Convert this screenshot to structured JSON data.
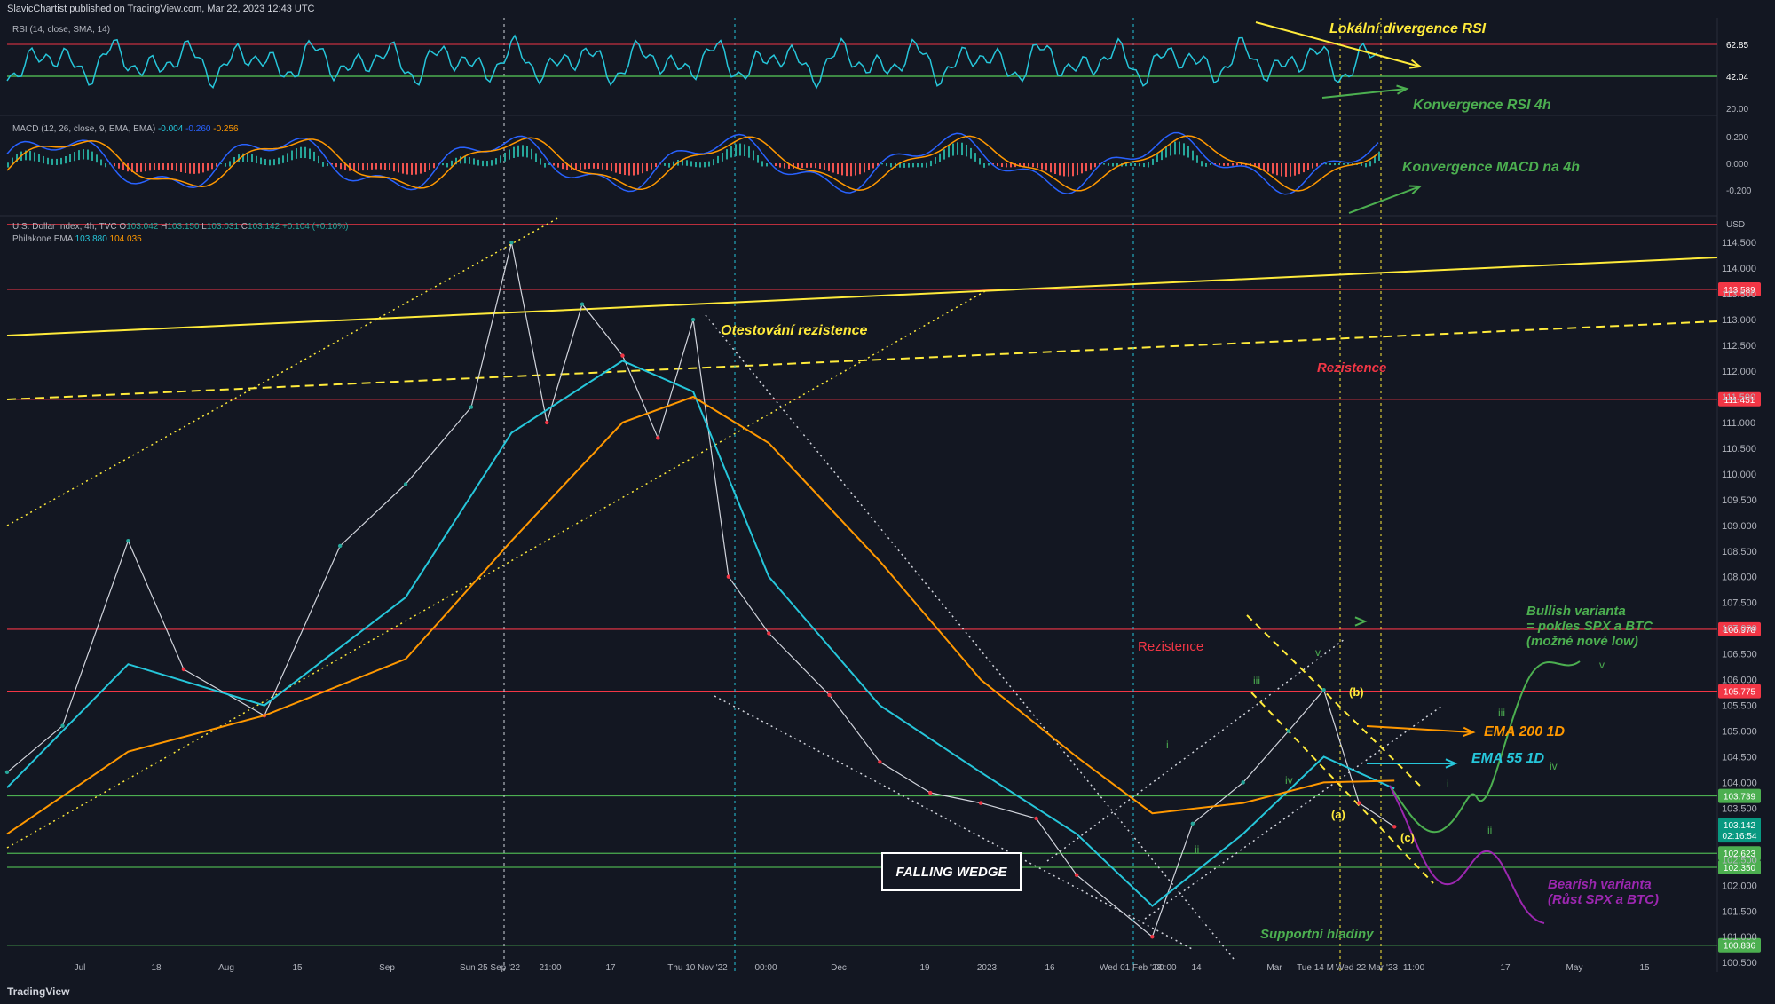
{
  "header": {
    "published": "SlavicChartist published on TradingView.com, Mar 22, 2023 12:43 UTC",
    "brand": "TradingView"
  },
  "rsi_pane": {
    "label": "RSI (14, close, SMA, 14)",
    "axis_ticks": [
      "62.85",
      "42.04",
      "20.00"
    ]
  },
  "macd_pane": {
    "label": "MACD (12, 26, close, 9, EMA, EMA)",
    "hist": "-0.004",
    "macd": "-0.260",
    "signal": "-0.256",
    "axis_ticks": [
      "0.200",
      "0.000",
      "-0.200"
    ]
  },
  "price_pane": {
    "symbol": "U.S. Dollar Index, 4h, TVC",
    "ohlc": {
      "o": "103.042",
      "h": "103.150",
      "l": "103.031",
      "c": "103.142",
      "chg": "+0.104 (+0.10%)"
    },
    "ema_label": "Philakone EMA",
    "ema_fast": "103.880",
    "ema_slow": "104.035",
    "currency": "USD",
    "current_price": "103.142",
    "countdown": "02:16:54"
  },
  "colors": {
    "background": "#131722",
    "rsi": "#26c6da",
    "ema55": "#26c6da",
    "ema200": "#ff9800",
    "resistance": "#f23645",
    "support": "#4caf50",
    "annotation_yellow": "#ffeb3b",
    "bullish": "#4caf50",
    "bearish": "#9c27b0"
  },
  "annotations": {
    "lokalni_divergence": "Lokální divergence RSI",
    "konvergence_rsi": "Konvergence RSI 4h",
    "konvergence_macd": "Konvergence MACD na 4h",
    "otestovani": "Otestování rezistence",
    "rezistence_top": "Rezistence",
    "rezistence_mid": "Rezistence",
    "falling_wedge": "FALLING WEDGE",
    "bullish_1": "Bullish varianta",
    "bullish_2": "= pokles SPX a BTC",
    "bullish_3": "(možné nové low)",
    "ema200": "EMA 200 1D",
    "ema55": "EMA 55 1D",
    "bearish_1": "Bearish varianta",
    "bearish_2": "(Růst SPX a BTC)",
    "supportni": "Supportní hladiny",
    "wave_b": "(b)",
    "wave_a": "(a)",
    "wave_c": "(c)",
    "wave_iii": "iii",
    "wave_i": "i",
    "wave_iv": "iv",
    "wave_ii": "ii",
    "wave_v": "v",
    "wave_i2": "i",
    "wave_iii2": "iii",
    "wave_ii2": "ii",
    "wave_iv2": "iv",
    "wave_v2": "v"
  },
  "chart_data": {
    "type": "line",
    "title": "U.S. Dollar Index, 4h, TVC",
    "price_axis_ticks": [
      114.5,
      114.0,
      113.5,
      113.0,
      112.5,
      112.0,
      111.5,
      111.0,
      110.5,
      110.0,
      109.5,
      109.0,
      108.5,
      108.0,
      107.5,
      107.0,
      106.5,
      106.0,
      105.5,
      105.0,
      104.5,
      104.0,
      103.5,
      103.0,
      102.5,
      102.0,
      101.5,
      101.0,
      100.5
    ],
    "ylim": [
      100.4,
      114.9
    ],
    "horizontal_levels": [
      {
        "name": "resistance",
        "value": 114.85,
        "label": ""
      },
      {
        "name": "resistance",
        "value": 113.589,
        "label": "113.589"
      },
      {
        "name": "resistance",
        "value": 111.451,
        "label": "111.451"
      },
      {
        "name": "resistance",
        "value": 106.978,
        "label": "106.978"
      },
      {
        "name": "resistance",
        "value": 105.775,
        "label": "105.775"
      },
      {
        "name": "support",
        "value": 103.739,
        "label": "103.739"
      },
      {
        "name": "support",
        "value": 102.623,
        "label": "102.623"
      },
      {
        "name": "support",
        "value": 102.35,
        "label": "102.350"
      },
      {
        "name": "support",
        "value": 100.836,
        "label": "100.836"
      }
    ],
    "time_axis_ticks": [
      "Jul",
      "18",
      "Aug",
      "15",
      "Sep",
      "Sun 25 Sep '22",
      "21:00",
      "17",
      "Thu 10 Nov '22",
      "00:00",
      "Dec",
      "19",
      "2023",
      "16",
      "Wed 01 Feb '23",
      "00:00",
      "14",
      "Mar",
      "Tue 14 M",
      "Wed 22 Mar '23",
      "11:00",
      "17",
      "May",
      "15"
    ],
    "x_range": [
      "2022-06-20",
      "2023-05-25"
    ],
    "series": [
      {
        "name": "",
        "x": [
          "2022-06-20",
          "2022-07-01",
          "2022-07-14",
          "2022-07-25",
          "2022-08-10",
          "2022-08-25",
          "2022-09-07",
          "2022-09-20",
          "2022-09-28",
          "2022-10-05",
          "2022-10-12",
          "2022-10-20",
          "2022-10-27",
          "2022-11-03",
          "2022-11-10",
          "2022-11-18",
          "2022-11-30",
          "2022-12-10",
          "2022-12-20",
          "2022-12-30",
          "2023-01-10",
          "2023-01-18",
          "2023-02-02",
          "2023-02-10",
          "2023-02-20",
          "2023-03-01",
          "2023-03-08",
          "2023-03-15",
          "2023-03-22"
        ],
        "values": [
          104.2,
          105.1,
          108.7,
          106.2,
          105.3,
          108.6,
          109.8,
          111.3,
          114.5,
          111.0,
          113.3,
          112.3,
          110.7,
          113.0,
          108.0,
          106.9,
          105.7,
          104.4,
          103.8,
          103.6,
          103.3,
          102.2,
          101.0,
          103.2,
          104.0,
          105.0,
          105.8,
          103.6,
          103.14
        ]
      },
      {
        "name": "",
        "x": [
          "2022-06-20",
          "2022-07-14",
          "2022-08-10",
          "2022-09-07",
          "2022-09-28",
          "2022-10-20",
          "2022-11-03",
          "2022-11-18",
          "2022-12-10",
          "2022-12-30",
          "2023-01-18",
          "2023-02-02",
          "2023-02-20",
          "2023-03-08",
          "2023-03-22"
        ],
        "values": [
          103.9,
          106.3,
          105.5,
          107.6,
          110.8,
          112.2,
          111.6,
          108.0,
          105.5,
          104.2,
          103.0,
          101.6,
          103.0,
          104.5,
          103.88
        ]
      },
      {
        "name": "",
        "x": [
          "2022-06-20",
          "2022-07-14",
          "2022-08-10",
          "2022-09-07",
          "2022-09-28",
          "2022-10-20",
          "2022-11-03",
          "2022-11-18",
          "2022-12-10",
          "2022-12-30",
          "2023-01-18",
          "2023-02-02",
          "2023-02-20",
          "2023-03-08",
          "2023-03-22"
        ],
        "values": [
          103.0,
          104.6,
          105.3,
          106.4,
          108.7,
          111.0,
          111.5,
          110.6,
          108.3,
          106.0,
          104.5,
          103.4,
          103.6,
          104.0,
          104.035
        ]
      }
    ]
  }
}
